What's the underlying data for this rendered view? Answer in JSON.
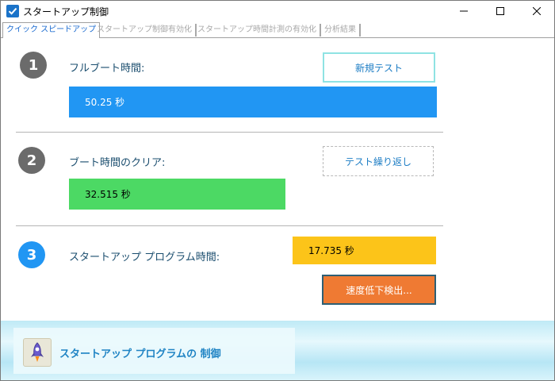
{
  "window": {
    "title": "スタートアップ制御"
  },
  "tabs": [
    {
      "label": "クイック スピードアップ"
    },
    {
      "label": "スタートアップ制御有効化"
    },
    {
      "label": "スタートアップ時間計測の有効化"
    },
    {
      "label": "分析結果"
    }
  ],
  "sections": [
    {
      "number": "1",
      "label": "フルブート時間:",
      "value": "50.25 秒",
      "value_color": "#2196f3",
      "button": "新規テスト"
    },
    {
      "number": "2",
      "label": "ブート時間のクリア:",
      "value": "32.515 秒",
      "value_color": "#4cd964",
      "button": "テスト繰り返し"
    },
    {
      "number": "3",
      "label": "スタートアップ プログラム時間:",
      "value": "17.735 秒",
      "value_color": "#fcc419",
      "button": "速度低下検出..."
    }
  ],
  "footer": {
    "text": "スタートアップ プログラムの 制御",
    "icon": "rocket-icon"
  },
  "colors": {
    "accent": "#1b6bd0",
    "bar1": "#2196f3",
    "bar2": "#4cd964",
    "bar3": "#fcc419",
    "detect_button": "#ef7a33"
  }
}
